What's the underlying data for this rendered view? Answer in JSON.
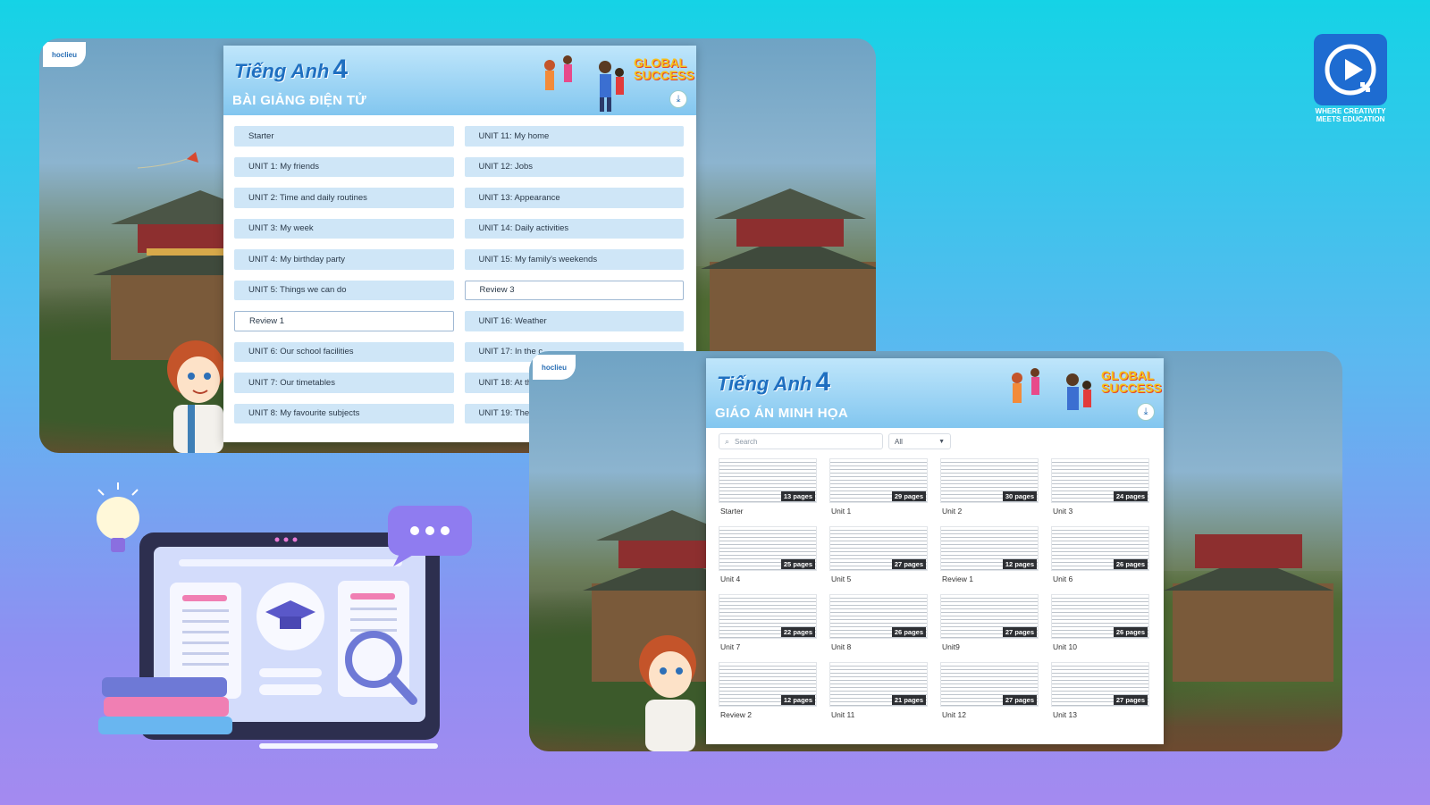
{
  "top_window": {
    "logo": "hoclieu",
    "brand_title": "Tiếng Anh",
    "brand_number": "4",
    "subtitle": "BÀI GIẢNG ĐIỆN TỬ",
    "series_logo": "GLOBAL SUCCESS",
    "download_icon": "download-icon",
    "units_left": [
      "Starter",
      "UNIT 1: My friends",
      "UNIT 2: Time and daily routines",
      "UNIT 3: My week",
      "UNIT 4: My birthday party",
      "UNIT 5: Things we can do",
      "Review 1",
      "UNIT 6: Our school facilities",
      "UNIT 7: Our timetables",
      "UNIT 8: My favourite subjects"
    ],
    "units_right": [
      "UNIT 11: My home",
      "UNIT 12: Jobs",
      "UNIT 13: Appearance",
      "UNIT 14: Daily activities",
      "UNIT 15: My family's weekends",
      "Review 3",
      "UNIT 16: Weather",
      "UNIT 17: In the c",
      "UNIT 18: At th",
      "UNIT 19: The"
    ]
  },
  "bottom_window": {
    "logo": "hoclieu",
    "brand_title": "Tiếng Anh",
    "brand_number": "4",
    "subtitle": "GIÁO ÁN MINH HỌA",
    "series_logo": "GLOBAL SUCCESS",
    "search_placeholder": "Search",
    "filter_value": "All",
    "documents": [
      {
        "name": "Starter",
        "pages": "13 pages"
      },
      {
        "name": "Unit 1",
        "pages": "29 pages"
      },
      {
        "name": "Unit 2",
        "pages": "30 pages"
      },
      {
        "name": "Unit 3",
        "pages": "24 pages"
      },
      {
        "name": "Unit 4",
        "pages": "25 pages"
      },
      {
        "name": "Unit 5",
        "pages": "27 pages"
      },
      {
        "name": "Review 1",
        "pages": "12 pages"
      },
      {
        "name": "Unit 6",
        "pages": "26 pages"
      },
      {
        "name": "Unit 7",
        "pages": "22 pages"
      },
      {
        "name": "Unit 8",
        "pages": "26 pages"
      },
      {
        "name": "Unit9",
        "pages": "27 pages"
      },
      {
        "name": "Unit 10",
        "pages": "26 pages"
      },
      {
        "name": "Review 2",
        "pages": "12 pages"
      },
      {
        "name": "Unit 11",
        "pages": "21 pages"
      },
      {
        "name": "Unit 12",
        "pages": "27 pages"
      },
      {
        "name": "Unit 13",
        "pages": "27 pages"
      }
    ]
  },
  "corner_logo": {
    "tagline_1": "WHERE CREATIVITY",
    "tagline_2": "MEETS EDUCATION"
  },
  "colors": {
    "accent_blue": "#1f6fc0",
    "unit_button": "#cfe6f7",
    "header_gradient_top": "#bfe6fb"
  }
}
